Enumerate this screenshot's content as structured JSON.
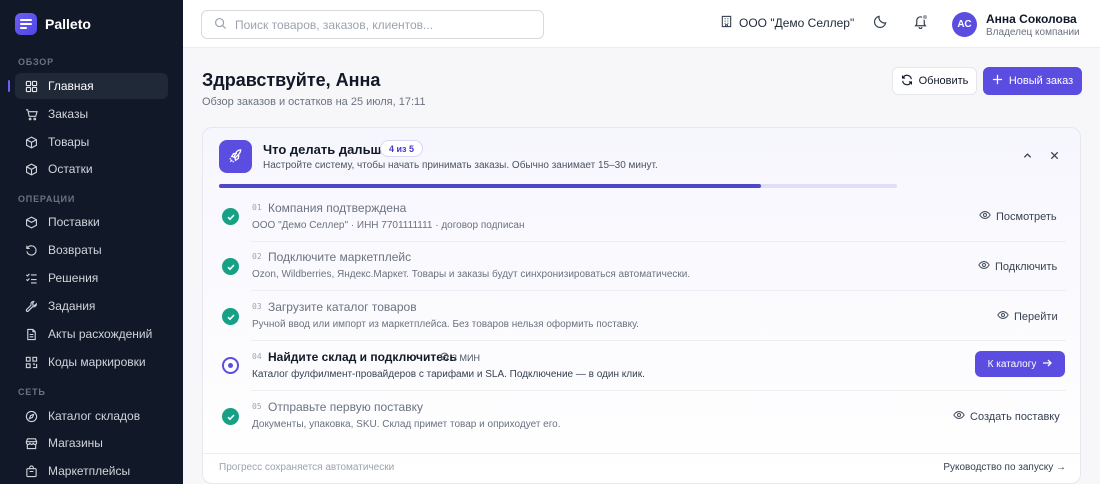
{
  "brand": {
    "name": "Palleto"
  },
  "sidebar": {
    "sections": [
      {
        "label": "ОБЗОР",
        "items": [
          {
            "label": "Главная",
            "icon": "grid-icon",
            "active": true
          },
          {
            "label": "Заказы",
            "icon": "cart-icon"
          },
          {
            "label": "Товары",
            "icon": "box-icon"
          },
          {
            "label": "Остатки",
            "icon": "layers-icon"
          }
        ]
      },
      {
        "label": "ОПЕРАЦИИ",
        "items": [
          {
            "label": "Поставки",
            "icon": "truck-icon"
          },
          {
            "label": "Возвраты",
            "icon": "return-icon"
          },
          {
            "label": "Решения",
            "icon": "checklist-icon"
          },
          {
            "label": "Задания",
            "icon": "wrench-icon"
          },
          {
            "label": "Акты расхождений",
            "icon": "document-icon"
          },
          {
            "label": "Коды маркировки",
            "icon": "qr-icon"
          }
        ]
      },
      {
        "label": "СЕТЬ",
        "items": [
          {
            "label": "Каталог складов",
            "icon": "compass-icon"
          },
          {
            "label": "Магазины",
            "icon": "store-icon"
          },
          {
            "label": "Маркетплейсы",
            "icon": "bag-icon"
          }
        ]
      }
    ]
  },
  "topbar": {
    "search_placeholder": "Поиск товаров, заказов, клиентов...",
    "org_name": "ООО \"Демо Селлер\"",
    "user": {
      "initials": "АС",
      "name": "Анна Соколова",
      "role": "Владелец компании"
    }
  },
  "header": {
    "title": "Здравствуйте, Анна",
    "subtitle": "Обзор заказов и остатков на 25 июля, 17:11",
    "refresh_label": "Обновить",
    "new_order_label": "Новый заказ"
  },
  "onboarding": {
    "title": "Что делать дальше",
    "badge": "4 из 5",
    "description": "Настройте систему, чтобы начать принимать заказы. Обычно занимает 15–30 минут.",
    "progress": 0.8,
    "steps": [
      {
        "num": "01",
        "title": "Компания подтверждена",
        "desc": "ООО \"Демо Селлер\" · ИНН 7701111111 · договор подписан",
        "done": true,
        "action": "Посмотреть"
      },
      {
        "num": "02",
        "title": "Подключите маркетплейс",
        "desc": "Ozon, Wildberries, Яндекс.Маркет. Товары и заказы будут синхронизироваться автоматически.",
        "done": true,
        "action": "Подключить"
      },
      {
        "num": "03",
        "title": "Загрузите каталог товаров",
        "desc": "Ручной ввод или импорт из маркетплейса. Без товаров нельзя оформить поставку.",
        "done": true,
        "action": "Перейти"
      },
      {
        "num": "04",
        "title": "Найдите склад и подключитесь",
        "desc": "Каталог фулфилмент-провайдеров с тарифами и SLA. Подключение — в один клик.",
        "done": false,
        "current": true,
        "time": "3 МИН",
        "action": "К каталогу"
      },
      {
        "num": "05",
        "title": "Отправьте первую поставку",
        "desc": "Документы, упаковка, SKU. Склад примет товар и оприходует его.",
        "done": true,
        "action": "Создать поставку"
      }
    ],
    "footer_left": "Прогресс сохраняется автоматически",
    "footer_right": "Руководство по запуску →"
  }
}
